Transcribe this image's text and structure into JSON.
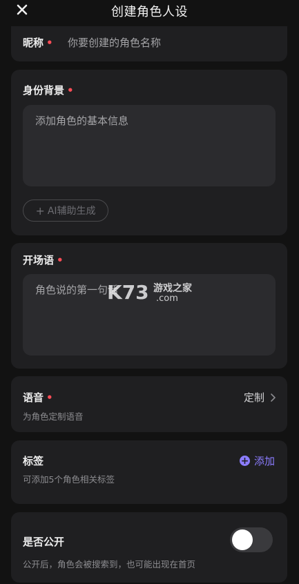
{
  "header": {
    "title": "创建角色人设"
  },
  "nickname": {
    "label": "昵称",
    "required_mark": "•",
    "placeholder": "你要创建的角色名称"
  },
  "background": {
    "label": "身份背景",
    "required_mark": "•",
    "placeholder": "添加角色的基本信息",
    "ai_button": "AI辅助生成"
  },
  "opening": {
    "label": "开场语",
    "required_mark": "•",
    "placeholder": "角色说的第一句话"
  },
  "voice": {
    "label": "语音",
    "required_mark": "•",
    "hint": "为角色定制语音",
    "action": "定制"
  },
  "tags": {
    "label": "标签",
    "hint": "可添加5个角色相关标签",
    "action": "添加"
  },
  "public": {
    "label": "是否公开",
    "hint": "公开后，角色会被搜索到，也可能出现在首页",
    "enabled": false
  },
  "watermark": {
    "brand": "K73",
    "text1": "游戏之家",
    "text2": ".com"
  },
  "colors": {
    "accent": "#8b7cff",
    "required": "#ff4d57",
    "card": "#1f1f21",
    "background": "#121212"
  }
}
